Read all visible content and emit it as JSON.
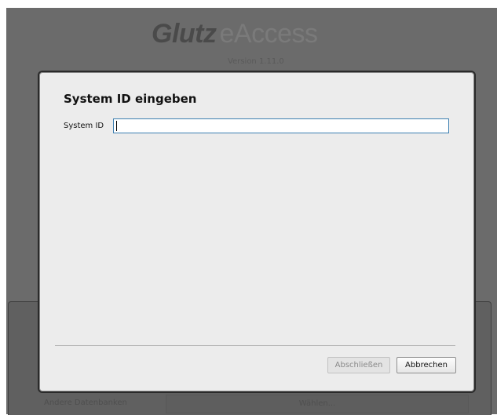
{
  "background": {
    "brand": "Glutz",
    "product": "eAccess",
    "version": "Version 1.11.0",
    "other_databases_label": "Andere Datenbanken",
    "choose_button": "Wählen..."
  },
  "dialog": {
    "title": "System ID eingeben",
    "system_id_label": "System ID",
    "system_id_value": "",
    "finish_button": "Abschließen",
    "cancel_button": "Abbrechen"
  },
  "colors": {
    "overlay": "#6b6b6b",
    "dialog_bg": "#ececec",
    "input_focus_border": "#3c7fb1"
  }
}
